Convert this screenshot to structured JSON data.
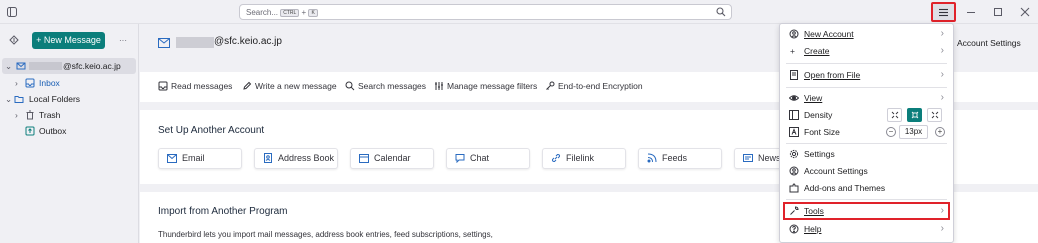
{
  "titlebar": {
    "search_placeholder": "Search...",
    "search_key1": "CTRL",
    "search_plus": "+",
    "search_key2": "K"
  },
  "sidebar": {
    "new_message_label": "New Message",
    "more_label": "···",
    "account_label": "@sfc.keio.ac.jp",
    "folders": [
      {
        "label": "Inbox"
      },
      {
        "label": "Local Folders"
      },
      {
        "label": "Trash"
      },
      {
        "label": "Outbox"
      }
    ]
  },
  "main": {
    "account_email": "@sfc.keio.ac.jp",
    "account_settings_label": "Account Settings",
    "actions": [
      {
        "label": "Read messages"
      },
      {
        "label": "Write a new message"
      },
      {
        "label": "Search messages"
      },
      {
        "label": "Manage message filters"
      },
      {
        "label": "End-to-end Encryption"
      }
    ],
    "setup_title": "Set Up Another Account",
    "account_types": [
      {
        "label": "Email"
      },
      {
        "label": "Address Book"
      },
      {
        "label": "Calendar"
      },
      {
        "label": "Chat"
      },
      {
        "label": "Filelink"
      },
      {
        "label": "Feeds"
      },
      {
        "label": "Newsgroups"
      }
    ],
    "import_title": "Import from Another Program",
    "import_text": "Thunderbird lets you import mail messages, address book entries, feed subscriptions, settings,"
  },
  "menu": {
    "items": [
      {
        "label": "New Account"
      },
      {
        "label": "Create"
      },
      {
        "label": "Open from File"
      },
      {
        "label": "View"
      },
      {
        "label": "Density"
      },
      {
        "label": "Font Size"
      },
      {
        "label": "Settings"
      },
      {
        "label": "Account Settings"
      },
      {
        "label": "Add-ons and Themes"
      },
      {
        "label": "Tools"
      },
      {
        "label": "Help"
      }
    ],
    "font_size_value": "13px",
    "font_minus": "−",
    "font_plus": "+"
  },
  "colors": {
    "accent": "#0b7e7b",
    "highlight": "#e0222a"
  }
}
